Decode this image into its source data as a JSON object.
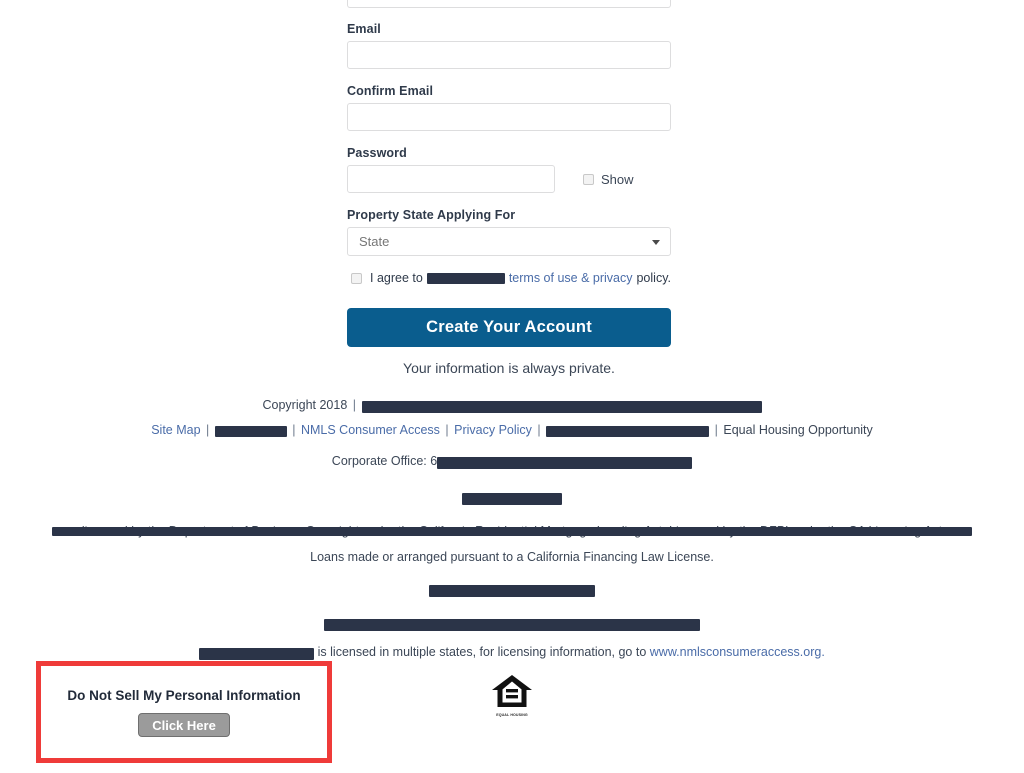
{
  "form": {
    "fields": [
      {
        "label": "",
        "placeholder": "",
        "cut_off": true
      },
      {
        "label": "Email",
        "placeholder": ""
      },
      {
        "label": "Confirm Email",
        "placeholder": ""
      }
    ],
    "password": {
      "label": "Password",
      "placeholder": "",
      "show_label": "Show"
    },
    "state": {
      "label": "Property State Applying For",
      "selected": "State"
    },
    "agree": {
      "prefix": "I agree to",
      "redacted": "██████████████",
      "link": "terms of use & privacy",
      "suffix": "policy."
    },
    "submit_label": "Create Your Account",
    "privacy_note": "Your information is always private."
  },
  "footer": {
    "copyright_prefix": "Copyright 2018",
    "links_row": {
      "site_map": "Site Map",
      "nmls": "NMLS Consumer Access",
      "privacy_policy": "Privacy Policy",
      "equal_housing": "Equal Housing Opportunity"
    },
    "corporate_office_prefix": "Corporate Office: 6",
    "dbo_line_partial": "licensed by the Department of Business Oversight under the California Residential Mortgage Lending Act. Licensed by the DFPI under the CA Licensing Act",
    "california_license": "Loans made or arranged pursuant to a California Financing Law License.",
    "multi_state_text": "is licensed in multiple states, for licensing information, go to",
    "nmls_url": "www.nmlsconsumeraccess.org.",
    "eho_logo_label_line1": "EQUAL HOUSING",
    "eho_logo_label_line2": "OPPORTUNITY",
    "separator": "|"
  },
  "do_not_sell": {
    "title": "Do Not Sell My Personal Information",
    "button_label": "Click Here"
  },
  "colors": {
    "accent_button": "#0a5d8e",
    "link": "#4a6ca8",
    "redaction": "#2b3448",
    "highlight_border": "#ef3b39",
    "text": "#3b4656",
    "grey_button": "#9b9b9b"
  }
}
